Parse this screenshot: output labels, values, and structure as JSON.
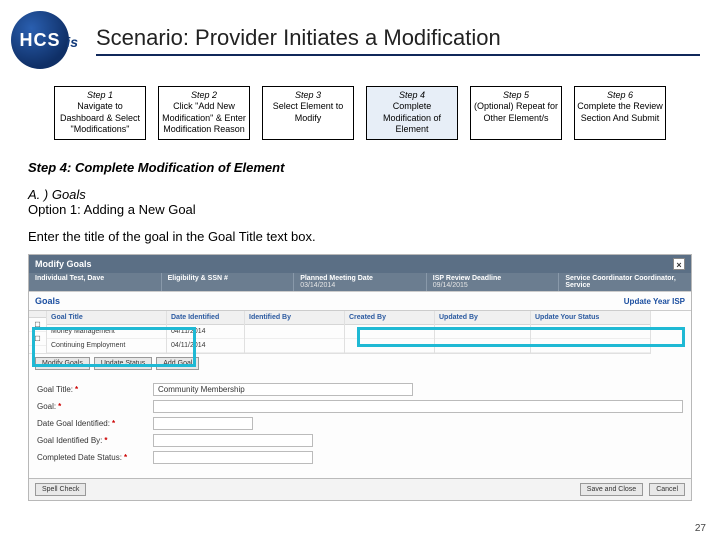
{
  "header": {
    "logo_hc": "HCS",
    "logo_is": "is",
    "title": "Scenario: Provider Initiates a Modification"
  },
  "steps": [
    {
      "label": "Step 1",
      "text": "Navigate to Dashboard & Select \"Modifications\""
    },
    {
      "label": "Step 2",
      "text": "Click \"Add New Modification\" & Enter Modification Reason"
    },
    {
      "label": "Step 3",
      "text": "Select Element to Modify"
    },
    {
      "label": "Step 4",
      "text": "Complete Modification of Element"
    },
    {
      "label": "Step 5",
      "text": "(Optional) Repeat for Other Element/s"
    },
    {
      "label": "Step 6",
      "text": "Complete the Review Section And Submit"
    }
  ],
  "section_heading": "Step 4: Complete Modification of Element",
  "subhead": "A. ) Goals",
  "subhead2": "Option 1: Adding a New Goal",
  "instruction": "Enter the title of the goal in the Goal Title text box.",
  "panel": {
    "title": "Modify Goals",
    "close": "×",
    "meta": {
      "c1_label": "Individual Test, Dave",
      "c2_label": "Eligibility & SSN #",
      "c3_label": "Planned Meeting Date",
      "c3_value": "03/14/2014",
      "c4_label": "ISP Review Deadline",
      "c4_value": "09/14/2015",
      "c5_label": "Service Coordinator Coordinator, Service"
    },
    "goals_label": "Goals",
    "update_link": "Update Year ISP",
    "columns": [
      "",
      "Goal Title",
      "Date Identified",
      "Identified By",
      "Created By",
      "Updated By",
      "Update Your Status"
    ],
    "rows": [
      {
        "title": "Money Management",
        "date": "04/11/2014"
      },
      {
        "title": "Continuing Employment",
        "date": "04/11/2014"
      }
    ],
    "inline_buttons": [
      "Modify Goals",
      "Update Status",
      "Add Goal"
    ],
    "form": {
      "goal_title_label": "Goal Title:",
      "goal_title_value": "Community Membership",
      "goal_label": "Goal:",
      "date_gi_label": "Date Goal Identified:",
      "gi_by_label": "Goal Identified By:",
      "completed_label": "Completed Date Status:"
    },
    "bottom_buttons_left": "Spell Check",
    "bottom_buttons_right": [
      "Save and Close",
      "Cancel"
    ]
  },
  "page_number": "27"
}
